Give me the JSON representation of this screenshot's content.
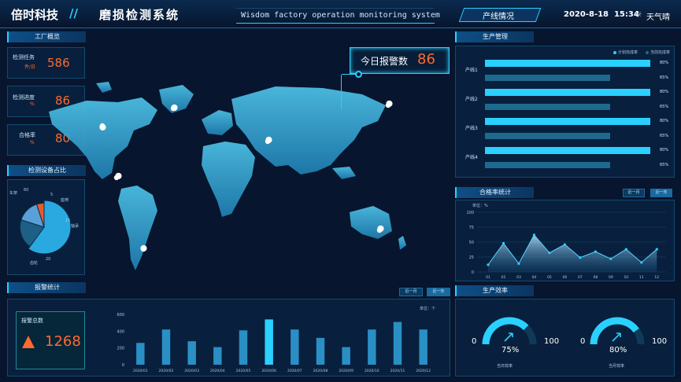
{
  "header": {
    "logo": "倍时科技",
    "separator": "//",
    "title": "磨损检测系统",
    "subtitle": "Wisdom factory operation monitoring system",
    "nav_button": "产线情况",
    "datetime": "2020-8-18  15:34",
    "weather": "天气晴"
  },
  "factory_overview": {
    "title": "工厂概览",
    "cards": [
      {
        "label": "检测任务",
        "unit": "件/日",
        "value": "586"
      },
      {
        "label": "检测进度",
        "unit": "%",
        "value": "86"
      },
      {
        "label": "合格率",
        "unit": "%",
        "value": "80"
      }
    ]
  },
  "device_share": {
    "title": "检测设备占比",
    "slices": [
      {
        "label": "齿轮",
        "value": 60,
        "color": "#2aa9e0"
      },
      {
        "label": "车架",
        "value": 20,
        "color": "#1e5f86"
      },
      {
        "label": "轴承",
        "value": 15,
        "color": "#5aa0d8"
      },
      {
        "label": "座椅",
        "value": 5,
        "color": "#e85a2a"
      }
    ],
    "labels": {
      "l60": "60",
      "l5": "5",
      "l15": "15",
      "l20": "20",
      "n_frame": "车架",
      "n_seat": "座椅",
      "n_bearing": "轴承",
      "n_gear": "齿轮"
    }
  },
  "alarm_banner": {
    "label": "今日报警数",
    "value": "86"
  },
  "alarm_stats": {
    "title": "报警统计",
    "tab_month": "近一月",
    "tab_year": "近一年",
    "unit": "单位：个",
    "total_label": "报警总数",
    "total_value": "1268",
    "alert_icon": "warning-triangle-icon"
  },
  "production": {
    "title": "生产管理",
    "legend_plan": "计划完成率",
    "legend_current": "当前完成率",
    "lines": [
      {
        "name": "产线1",
        "plan": "80%",
        "current": "65%"
      },
      {
        "name": "产线2",
        "plan": "80%",
        "current": "65%"
      },
      {
        "name": "产线3",
        "plan": "80%",
        "current": "65%"
      },
      {
        "name": "产线4",
        "plan": "80%",
        "current": "65%"
      }
    ]
  },
  "pass_rate": {
    "title": "合格率统计",
    "tab_month": "近一月",
    "tab_year": "近一年",
    "unit": "单位：%"
  },
  "efficiency": {
    "title": "生产效率",
    "gauges": [
      {
        "min": "0",
        "max": "100",
        "value": "75%",
        "label": "当日效率",
        "pct": 0.75
      },
      {
        "min": "0",
        "max": "100",
        "value": "80%",
        "label": "当月效率",
        "pct": 0.8
      }
    ]
  },
  "colors": {
    "accent": "#2ad0ff",
    "orange": "#ff6a2e",
    "bar": "#2a8fc4",
    "bar_hi": "#2ad0ff"
  },
  "chart_data": [
    {
      "type": "bar",
      "title": "报警统计",
      "categories": [
        "2020/01",
        "2020/02",
        "2020/03",
        "2020/04",
        "2020/05",
        "2020/06",
        "2020/07",
        "2020/08",
        "2020/09",
        "2020/10",
        "2020/11",
        "2020/12"
      ],
      "values": [
        260,
        420,
        280,
        210,
        410,
        540,
        420,
        320,
        210,
        420,
        510,
        420
      ],
      "ylim": [
        0,
        600
      ],
      "yticks": [
        "0",
        "200",
        "400",
        "600"
      ]
    },
    {
      "type": "area",
      "title": "合格率统计",
      "categories": [
        "01",
        "02",
        "03",
        "04",
        "05",
        "06",
        "07",
        "08",
        "09",
        "10",
        "11",
        "12"
      ],
      "values": [
        12,
        48,
        14,
        62,
        32,
        46,
        24,
        34,
        22,
        38,
        16,
        38
      ],
      "ylim": [
        0,
        100
      ],
      "yticks": [
        "0",
        "25",
        "50",
        "75",
        "100"
      ]
    },
    {
      "type": "bar",
      "title": "生产管理",
      "categories": [
        "产线1",
        "产线2",
        "产线3",
        "产线4"
      ],
      "series": [
        {
          "name": "计划完成率",
          "values": [
            80,
            80,
            80,
            80
          ]
        },
        {
          "name": "当前完成率",
          "values": [
            65,
            65,
            65,
            65
          ]
        }
      ]
    }
  ]
}
